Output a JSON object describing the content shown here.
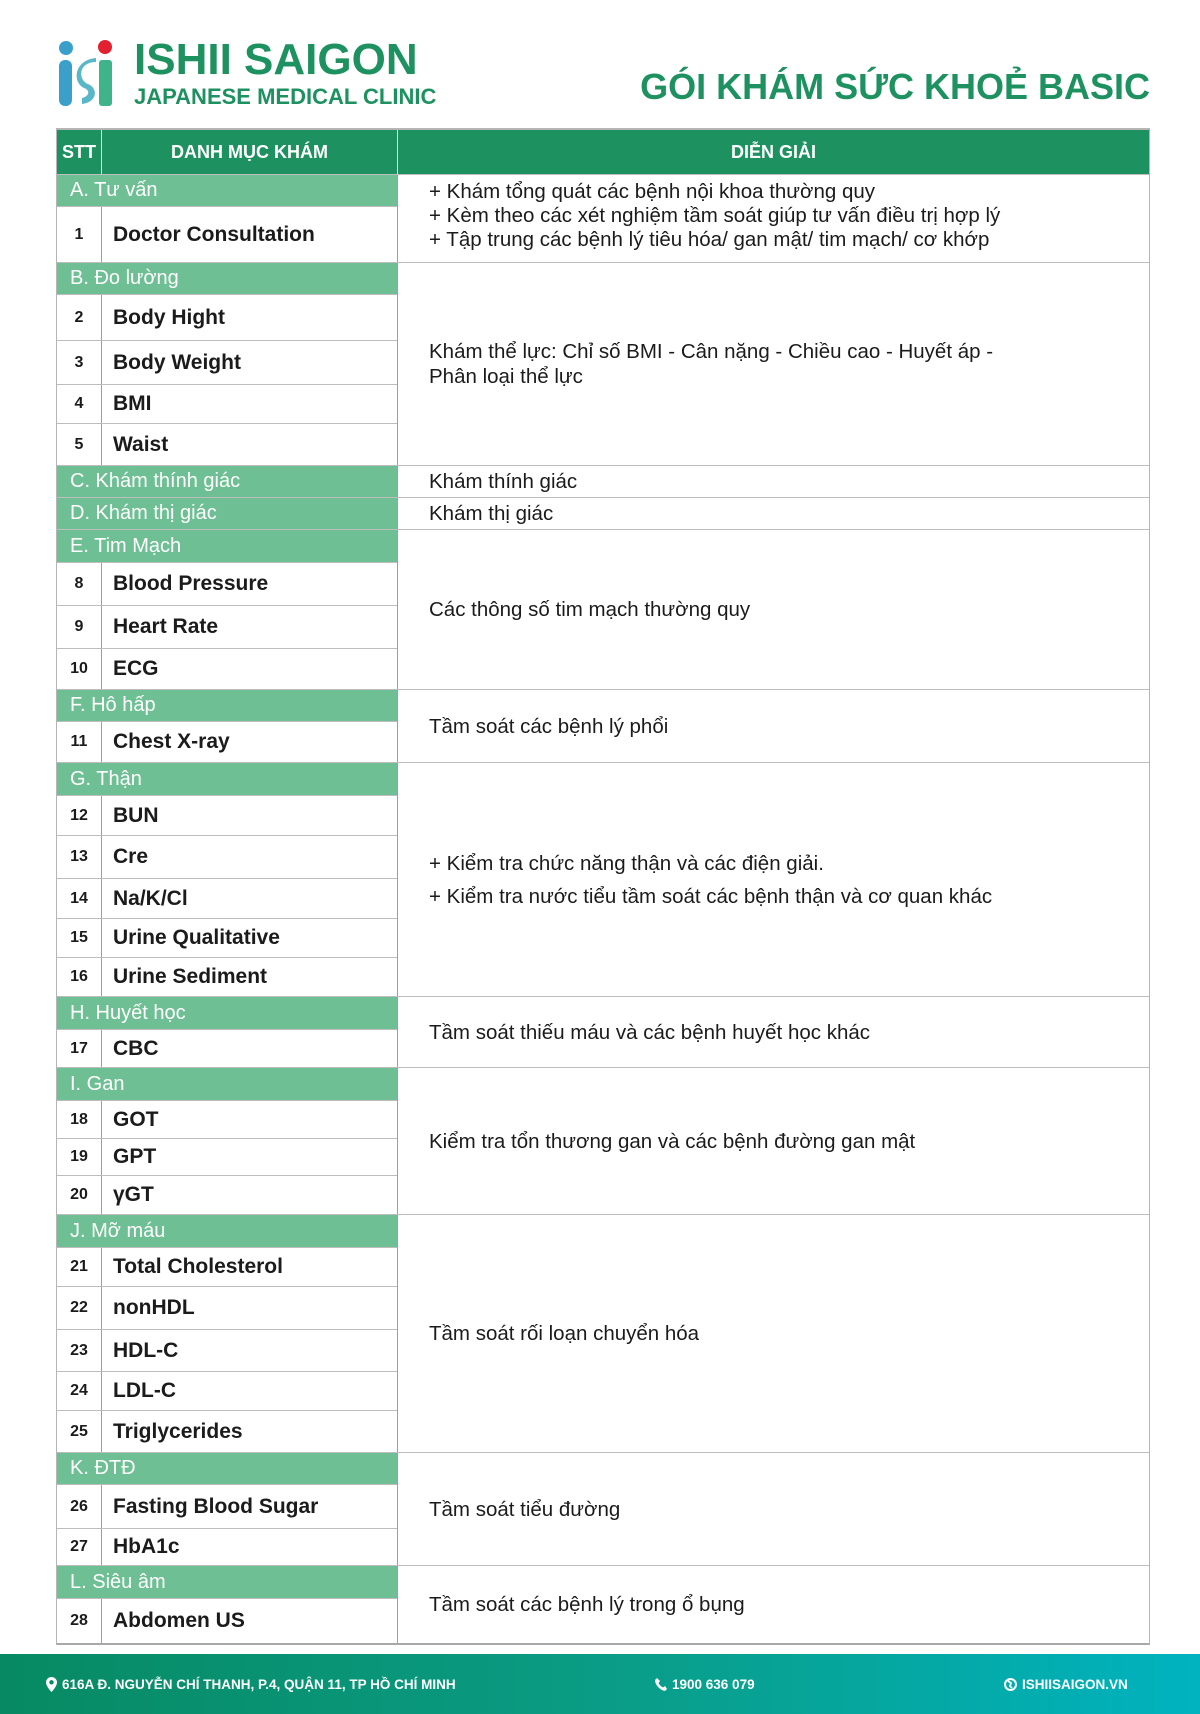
{
  "brand": {
    "name": "ISHII SAIGON",
    "subtitle": "JAPANESE MEDICAL CLINIC",
    "logo_colors": [
      "#3a9fc9",
      "#e3202f",
      "#3fb48a"
    ]
  },
  "title": "GÓI KHÁM SỨC KHOẺ BASIC",
  "colors": {
    "header": "#1e9160",
    "section": "#6fbf94",
    "title": "#1e9160"
  },
  "table": {
    "headers": [
      "STT",
      "DANH MỤC KHÁM",
      "DIỄN GIẢI"
    ],
    "sections": [
      {
        "label": "A. Tư vấn",
        "items": [
          {
            "no": "1",
            "name": "Doctor Consultation"
          }
        ],
        "description": [
          "+ Khám tổng quát các bệnh nội khoa thường quy",
          "+ Kèm theo các xét nghiệm tầm soát giúp tư vấn điều trị hợp lý",
          "+ Tập trung các bệnh lý tiêu hóa/ gan mật/ tim mạch/ cơ khớp"
        ]
      },
      {
        "label": "B. Đo lường",
        "items": [
          {
            "no": "2",
            "name": "Body Hight"
          },
          {
            "no": "3",
            "name": "Body Weight"
          },
          {
            "no": "4",
            "name": "BMI"
          },
          {
            "no": "5",
            "name": "Waist"
          }
        ],
        "description": [
          "Khám thể lực: Chỉ số BMI - Cân nặng - Chiều cao - Huyết áp -",
          "Phân loại thể lực"
        ]
      },
      {
        "label": "C. Khám thính giác",
        "items": [],
        "description": [
          "Khám thính giác"
        ]
      },
      {
        "label": "D. Khám thị giác",
        "items": [],
        "description": [
          "Khám thị giác"
        ]
      },
      {
        "label": "E. Tim Mạch",
        "items": [
          {
            "no": "8",
            "name": "Blood Pressure"
          },
          {
            "no": "9",
            "name": "Heart Rate"
          },
          {
            "no": "10",
            "name": "ECG"
          }
        ],
        "description": [
          "Các thông số tim mạch thường quy"
        ]
      },
      {
        "label": "F. Hô hấp",
        "items": [
          {
            "no": "11",
            "name": "Chest X-ray"
          }
        ],
        "description": [
          "Tầm soát các bệnh lý phổi"
        ]
      },
      {
        "label": "G. Thận",
        "items": [
          {
            "no": "12",
            "name": "BUN"
          },
          {
            "no": "13",
            "name": "Cre"
          },
          {
            "no": "14",
            "name": "Na/K/Cl"
          },
          {
            "no": "15",
            "name": "Urine Qualitative"
          },
          {
            "no": "16",
            "name": "Urine Sediment"
          }
        ],
        "description": [
          "+ Kiểm tra chức năng thận và các điện giải.",
          "+ Kiểm tra nước tiểu tầm soát các bệnh thận và cơ quan khác"
        ]
      },
      {
        "label": "H. Huyết học",
        "items": [
          {
            "no": "17",
            "name": "CBC"
          }
        ],
        "description": [
          "Tầm soát thiếu máu và các bệnh huyết học khác"
        ]
      },
      {
        "label": "I. Gan",
        "items": [
          {
            "no": "18",
            "name": "GOT"
          },
          {
            "no": "19",
            "name": "GPT"
          },
          {
            "no": "20",
            "name": "γGT"
          }
        ],
        "description": [
          "Kiểm tra tổn thương gan và các bệnh đường gan mật"
        ]
      },
      {
        "label": "J. Mỡ máu",
        "items": [
          {
            "no": "21",
            "name": "Total Cholesterol"
          },
          {
            "no": "22",
            "name": "nonHDL"
          },
          {
            "no": "23",
            "name": "HDL-C"
          },
          {
            "no": "24",
            "name": "LDL-C"
          },
          {
            "no": "25",
            "name": "Triglycerides"
          }
        ],
        "description": [
          "Tầm soát rối loạn chuyển hóa"
        ]
      },
      {
        "label": "K. ĐTĐ",
        "items": [
          {
            "no": "26",
            "name": "Fasting Blood Sugar"
          },
          {
            "no": "27",
            "name": "HbA1c"
          }
        ],
        "description": [
          "Tầm soát tiểu đường"
        ]
      },
      {
        "label": "L. Siêu âm",
        "items": [
          {
            "no": "28",
            "name": "Abdomen US"
          }
        ],
        "description": [
          "Tầm soát các bệnh lý trong ổ bụng"
        ]
      }
    ]
  },
  "footer": {
    "address": "616A Đ. NGUYỄN CHÍ THANH, P.4, QUẬN 11, TP HỒ CHÍ MINH",
    "phone": "1900 636 079",
    "website": "ISHIISAIGON.VN",
    "address_icon": "map-pin-icon",
    "phone_icon": "phone-icon",
    "website_icon": "globe-icon"
  }
}
